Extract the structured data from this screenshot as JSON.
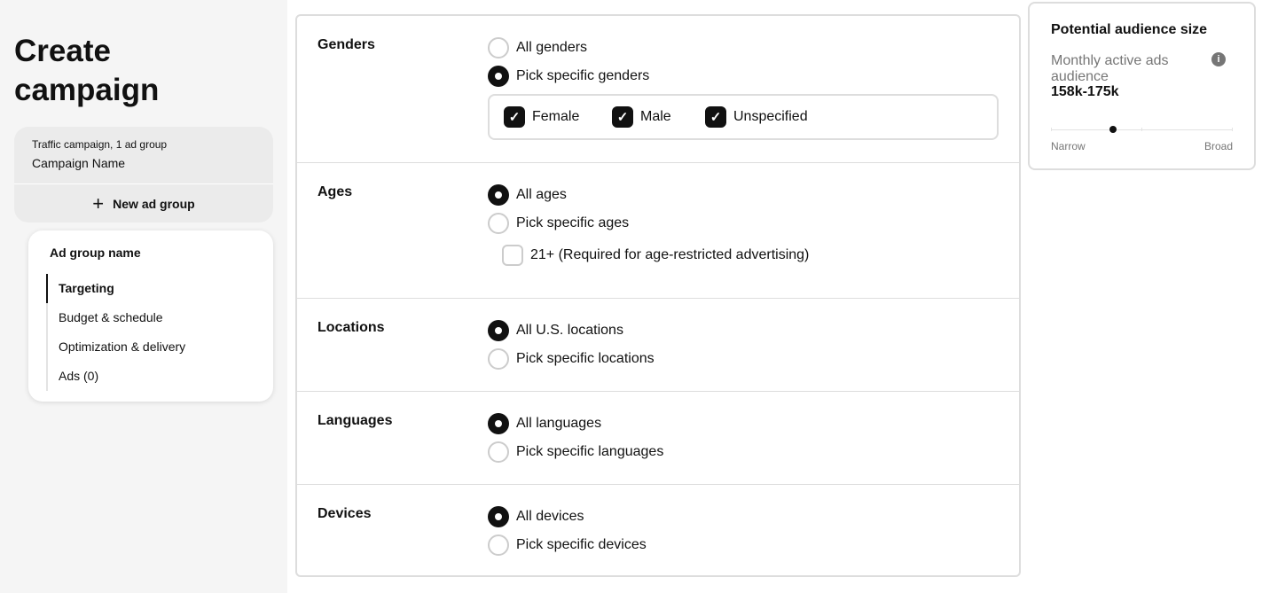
{
  "sidebar": {
    "title": "Create campaign",
    "campaign_type": "Traffic campaign, 1 ad group",
    "campaign_name": "Campaign Name",
    "new_ad_group": "New ad group",
    "ad_group": {
      "name": "Ad group name",
      "nav": [
        "Targeting",
        "Budget & schedule",
        "Optimization & delivery",
        "Ads (0)"
      ],
      "active": "Targeting"
    }
  },
  "main": {
    "genders": {
      "label": "Genders",
      "options": [
        "All genders",
        "Pick specific genders"
      ],
      "selected": 1,
      "checks": [
        {
          "label": "Female",
          "checked": true
        },
        {
          "label": "Male",
          "checked": true
        },
        {
          "label": "Unspecified",
          "checked": true
        }
      ]
    },
    "ages": {
      "label": "Ages",
      "options": [
        "All ages",
        "Pick specific ages"
      ],
      "selected": 0,
      "check": {
        "label": "21+ (Required for age-restricted advertising)",
        "checked": false
      }
    },
    "locations": {
      "label": "Locations",
      "options": [
        "All U.S. locations",
        "Pick specific locations"
      ],
      "selected": 0
    },
    "languages": {
      "label": "Languages",
      "options": [
        "All languages",
        "Pick specific languages"
      ],
      "selected": 0
    },
    "devices": {
      "label": "Devices",
      "options": [
        "All devices",
        "Pick specific devices"
      ],
      "selected": 0
    }
  },
  "audience": {
    "title": "Potential audience size",
    "metric": "Monthly active ads audience",
    "value": "158k-175k",
    "icon": "info-icon",
    "slider_level": 0.34,
    "narrow": "Narrow",
    "broad": "Broad"
  }
}
